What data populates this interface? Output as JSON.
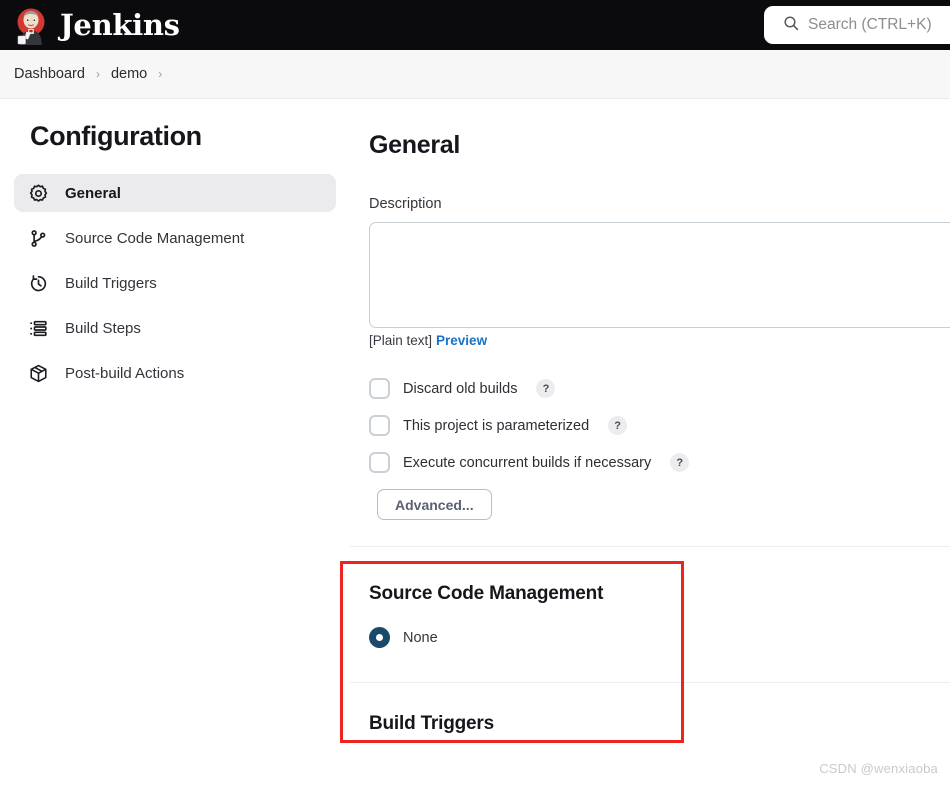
{
  "header": {
    "brand_title": "Jenkins",
    "logo_icon": "jenkins-butler-logo",
    "search": {
      "icon": "search-icon",
      "placeholder": "Search (CTRL+K)",
      "value": ""
    }
  },
  "breadcrumb": {
    "items": [
      {
        "label": "Dashboard"
      },
      {
        "label": "demo"
      }
    ],
    "separator": "›",
    "trailing_separator": "›"
  },
  "sidebar": {
    "title": "Configuration",
    "items": [
      {
        "label": "General",
        "icon": "gear-icon",
        "active": true
      },
      {
        "label": "Source Code Management",
        "icon": "git-branch-icon",
        "active": false
      },
      {
        "label": "Build Triggers",
        "icon": "timer-clock-icon",
        "active": false
      },
      {
        "label": "Build Steps",
        "icon": "list-bullets-icon",
        "active": false
      },
      {
        "label": "Post-build Actions",
        "icon": "package-box-icon",
        "active": false
      }
    ]
  },
  "main": {
    "heading": "General",
    "description": {
      "label": "Description",
      "value": "",
      "plain_text_note": "[Plain text]",
      "preview_link": "Preview"
    },
    "checkboxes": [
      {
        "label": "Discard old builds",
        "checked": false,
        "help": "?"
      },
      {
        "label": "This project is parameterized",
        "checked": false,
        "help": "?"
      },
      {
        "label": "Execute concurrent builds if necessary",
        "checked": false,
        "help": "?"
      }
    ],
    "advanced_button": "Advanced...",
    "scm_section": {
      "heading": "Source Code Management",
      "options": [
        {
          "label": "None",
          "selected": true
        }
      ]
    },
    "build_triggers_section": {
      "heading": "Build Triggers"
    }
  },
  "annotation": {
    "highlight_color": "#ef2222",
    "target": "Source Code Management"
  },
  "watermark": {
    "text": "CSDN @wenxiaoba"
  }
}
